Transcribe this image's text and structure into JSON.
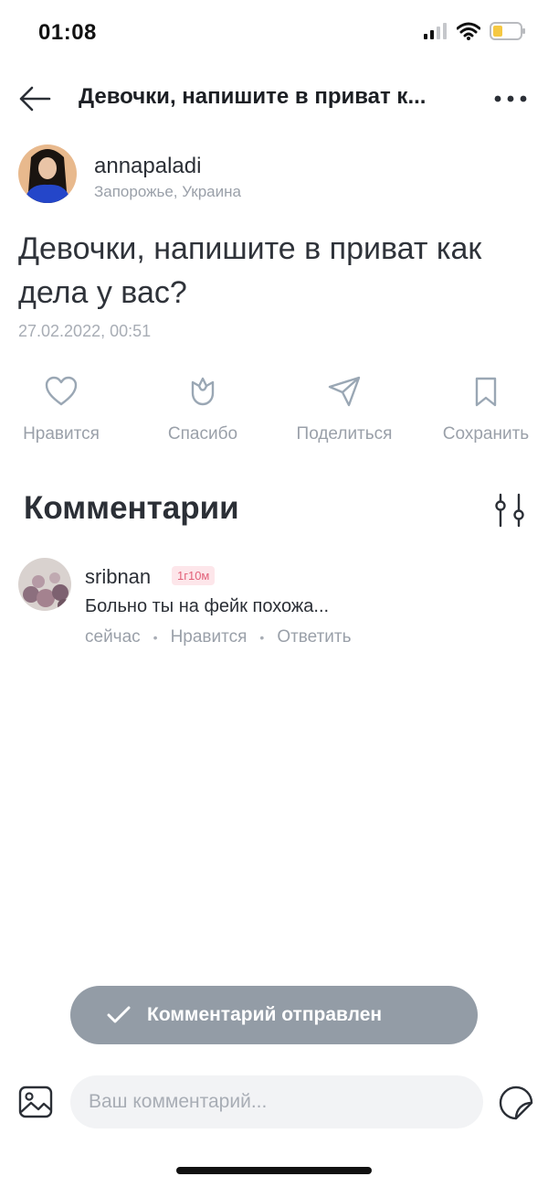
{
  "status_bar": {
    "time": "01:08",
    "icons": [
      "cellular-signal-icon",
      "wifi-icon",
      "battery-icon"
    ],
    "battery_color": "#f5c842"
  },
  "topbar": {
    "back_icon": "arrow-left-icon",
    "title": "Девочки, напишите в приват к...",
    "more_icon": "more-horizontal-icon"
  },
  "post": {
    "author": {
      "username": "annapaladi",
      "location": "Запорожье, Украина"
    },
    "text": "Девочки, напишите в приват как дела у вас?",
    "date": "27.02.2022, 00:51",
    "actions": [
      {
        "label": "Нравится",
        "icon": "heart-icon"
      },
      {
        "label": "Спасибо",
        "icon": "tulip-icon"
      },
      {
        "label": "Поделиться",
        "icon": "send-icon"
      },
      {
        "label": "Сохранить",
        "icon": "bookmark-icon"
      }
    ]
  },
  "comments": {
    "title": "Комментарии",
    "filter_icon": "filter-sliders-icon",
    "items": [
      {
        "username": "sribnan",
        "badge": "1г10м",
        "text": "Больно ты на фейк похожа...",
        "time": "сейчас",
        "like_label": "Нравится",
        "reply_label": "Ответить"
      }
    ]
  },
  "toast": {
    "icon": "checkmark-icon",
    "text": "Комментарий отправлен"
  },
  "composer": {
    "image_icon": "image-icon",
    "placeholder": "Ваш комментарий...",
    "sticker_icon": "sticker-icon"
  },
  "colors": {
    "muted_text": "#9aa0a9",
    "toast_bg": "#939ca6",
    "badge_bg": "#fde6ea",
    "badge_text": "#e2627a"
  }
}
